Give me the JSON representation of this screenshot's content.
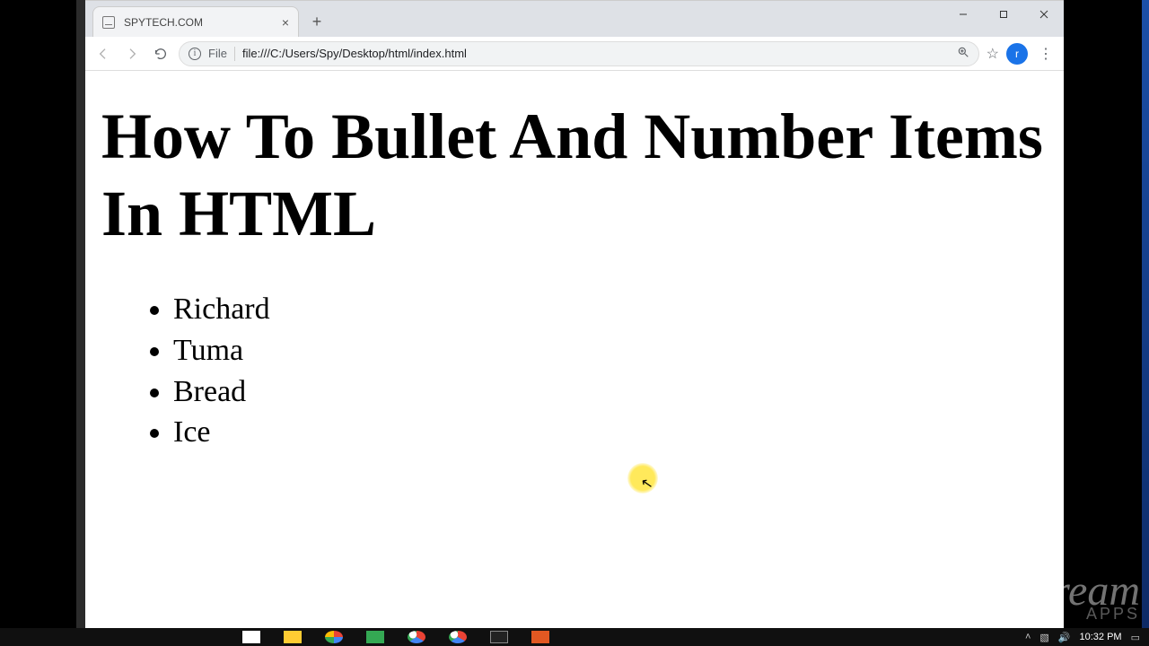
{
  "browser": {
    "tab": {
      "title": "SPYTECH.COM"
    },
    "omnibox": {
      "scheme_label": "File",
      "url": "file:///C:/Users/Spy/Desktop/html/index.html"
    },
    "avatar_initial": "r"
  },
  "page": {
    "heading": "How To Bullet And Number Items In HTML",
    "list_items": [
      "Richard",
      "Tuma",
      "Bread",
      "Ice"
    ]
  },
  "watermark": {
    "brand": "Icecream",
    "sub": "APPS"
  },
  "taskbar": {
    "clock": "10:32 PM"
  }
}
